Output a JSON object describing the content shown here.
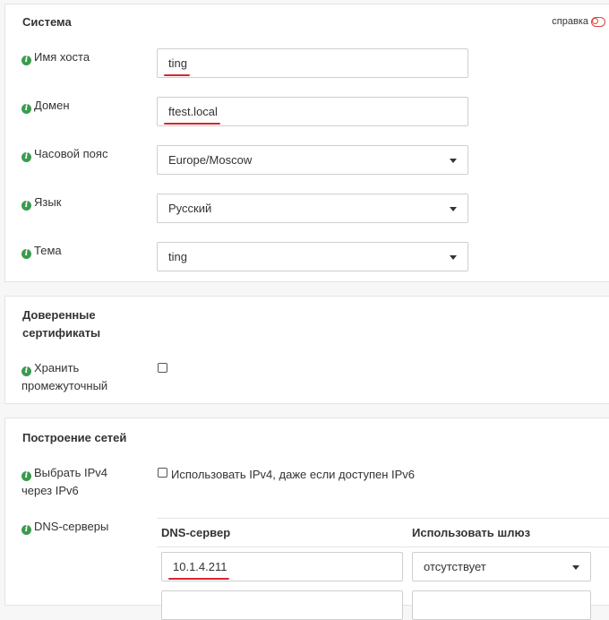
{
  "help": {
    "label": "справка"
  },
  "system": {
    "title": "Система",
    "hostname": {
      "label": "Имя хоста",
      "value": "ting"
    },
    "domain": {
      "label": "Домен",
      "value": "ftest.local"
    },
    "timezone": {
      "label": "Часовой пояс",
      "value": "Europe/Moscow"
    },
    "language": {
      "label": "Язык",
      "value": "Русский"
    },
    "theme": {
      "label": "Тема",
      "value": "ting"
    }
  },
  "certs": {
    "title_line1": "Доверенные",
    "title_line2": "сертификаты",
    "store_label_line1": "Хранить",
    "store_label_line2": "промежуточный",
    "store_checked": false
  },
  "networking": {
    "title": "Построение сетей",
    "ipv4_label_line1": "Выбрать IPv4",
    "ipv4_label_line2": "через IPv6",
    "ipv4_checkbox_label": "Использовать IPv4, даже если доступен IPv6",
    "ipv4_checked": false,
    "dns_label": "DNS-серверы",
    "dns_table": {
      "col_server": "DNS-сервер",
      "col_gateway": "Использовать шлюз",
      "rows": [
        {
          "server": "10.1.4.211",
          "gateway": "отсутствует"
        },
        {
          "server": "",
          "gateway": ""
        }
      ]
    }
  },
  "colors": {
    "accent_red": "#d9252e",
    "info_green": "#3a9b4f"
  }
}
